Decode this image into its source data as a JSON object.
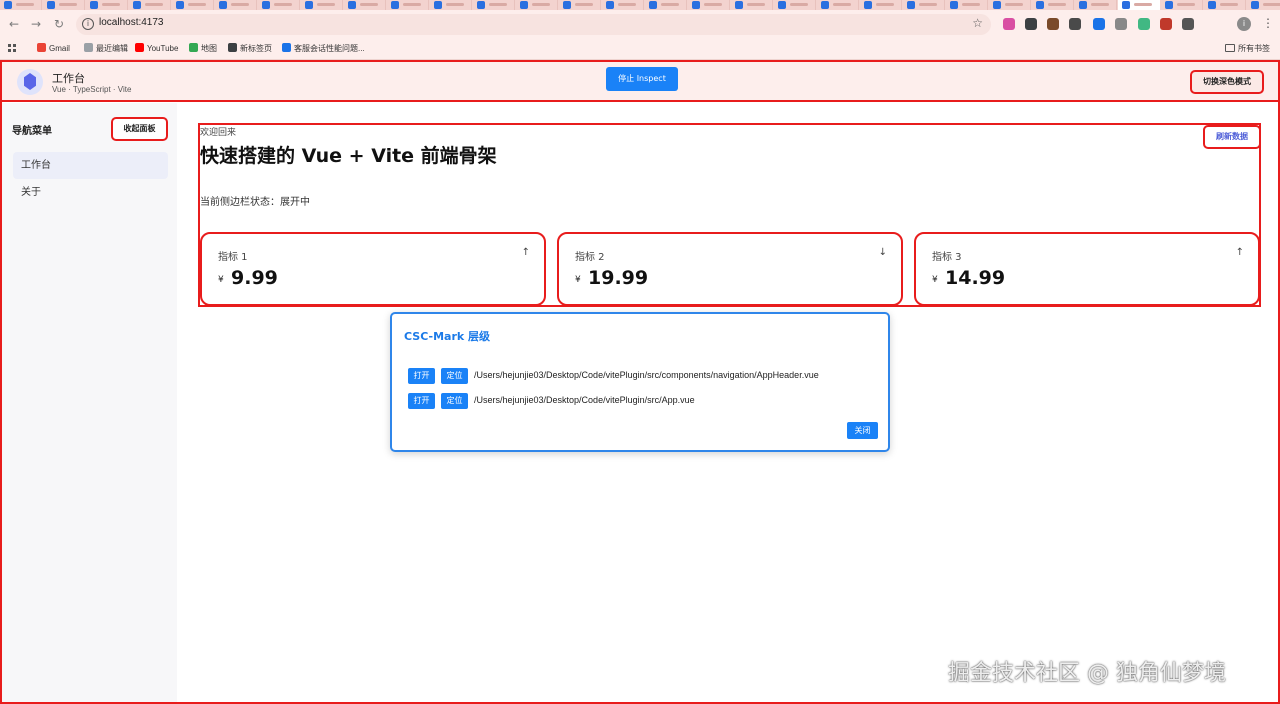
{
  "browser": {
    "url": "localhost:4173",
    "nav": {
      "back": "←",
      "forward": "→",
      "reload": "↻"
    },
    "bookmarks": [
      {
        "label": "Gmail",
        "color": "#ea4335"
      },
      {
        "label": "最近编辑",
        "color": "#9aa0a6"
      },
      {
        "label": "YouTube",
        "color": "#ff0000"
      },
      {
        "label": "地图",
        "color": "#34a853"
      },
      {
        "label": "新标签页",
        "color": "#3c4043"
      },
      {
        "label": "客服会话性能问题...",
        "color": "#1a73e8"
      }
    ],
    "all_bookmarks": "所有书签",
    "ext_badges": [
      "1",
      "1"
    ],
    "ext_colors": [
      "#d94fa3",
      "#3c4043",
      "#7a4a2a",
      "#4a4a4a",
      "#1a73e8",
      "#888888",
      "#41b883",
      "#c0392b",
      "#555555"
    ]
  },
  "header": {
    "title": "工作台",
    "subtitle": "Vue · TypeScript · Vite",
    "inspect_label": "停止 Inspect",
    "theme_label": "切换深色模式"
  },
  "sidebar": {
    "title": "导航菜单",
    "collapse_label": "收起面板",
    "items": [
      {
        "label": "工作台",
        "active": true
      },
      {
        "label": "关于",
        "active": false
      }
    ]
  },
  "main": {
    "welcome": "欢迎回来",
    "title": "快速搭建的 Vue + Vite 前端骨架",
    "state": "当前侧边栏状态：展开中",
    "refresh_label": "刷新数据",
    "cards": [
      {
        "label": "指标 1",
        "currency": "¥",
        "value": "9.99",
        "trend": "↑"
      },
      {
        "label": "指标 2",
        "currency": "¥",
        "value": "19.99",
        "trend": "↓"
      },
      {
        "label": "指标 3",
        "currency": "¥",
        "value": "14.99",
        "trend": "↑"
      }
    ]
  },
  "modal": {
    "title": "CSC-Mark 层级",
    "rows": [
      {
        "open": "打开",
        "locate": "定位",
        "path": "/Users/hejunjie03/Desktop/Code/vitePlugin/src/components/navigation/AppHeader.vue"
      },
      {
        "open": "打开",
        "locate": "定位",
        "path": "/Users/hejunjie03/Desktop/Code/vitePlugin/src/App.vue"
      }
    ],
    "close_label": "关闭"
  },
  "watermark": "掘金技术社区 @ 独角仙梦境"
}
